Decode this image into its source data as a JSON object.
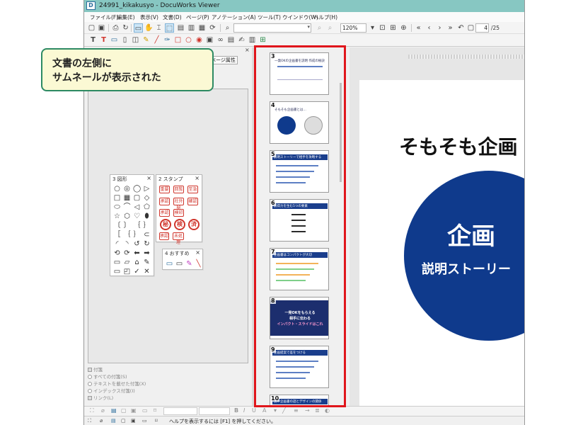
{
  "window": {
    "title": "24991_kikakusyo - DocuWorks Viewer",
    "app_icon": "docuworks-app-icon"
  },
  "menu": [
    "ファイル(F)",
    "編集(E)",
    "表示(V)",
    "文書(D)",
    "ページ(P)",
    "アノテーション(A)",
    "ツール(T)",
    "ウインドウ(W)",
    "ヘルプ(H)"
  ],
  "toolbar": {
    "zoom": "120%",
    "page_current": "4",
    "page_total": "/25"
  },
  "annotation_tabs": [
    "集",
    "ページ属性"
  ],
  "palettes": {
    "shapes": {
      "title": "3 図形"
    },
    "stamps": {
      "title": "2 スタンプ",
      "labels": [
        "重要",
        "回覧",
        "至急",
        "承認",
        "社外秘",
        "確認",
        "承認",
        "検印"
      ],
      "round": [
        "秘",
        "検",
        "済"
      ],
      "extra": [
        "承認",
        "未処理"
      ]
    },
    "recommended": {
      "title": "4 おすすめ"
    }
  },
  "fuseni": {
    "title": "付箋",
    "options": [
      "すべての付箋(S)",
      "テキストを載せた付箋(X)",
      "インデックス付箋(I)"
    ],
    "link": "リンク(L)"
  },
  "thumbnails": [
    {
      "num": "3",
      "kind": "title",
      "title": "一発OKの企画書を説明 作成の秘訣"
    },
    {
      "num": "4",
      "kind": "circles",
      "title": "そもそも企画書とは…"
    },
    {
      "num": "5",
      "kind": "list",
      "title": "説明ストーリーで相手を攻略する"
    },
    {
      "num": "6",
      "kind": "photo",
      "title": "説得力を生む5つの要素"
    },
    {
      "num": "7",
      "kind": "chart",
      "title": "企画書はコンパクトが大切"
    },
    {
      "num": "8",
      "kind": "dark",
      "title": "一発OKをもらえる\n相手に伝わる\nインパクト・スライドはこれ"
    },
    {
      "num": "9",
      "kind": "table",
      "title": "企画提案で差をつける"
    },
    {
      "num": "10",
      "kind": "bar",
      "title": "良い企画書の話とデザインの関係"
    }
  ],
  "slide": {
    "heading": "そもそも企画",
    "circle_title": "企画",
    "circle_sub": "説明ストーリー"
  },
  "status": "ヘルプを表示するには [F1] を押してください。",
  "callout": "文書の左側に\nサムネールが表示された",
  "colors": {
    "title_bar": "#87c7c2",
    "highlight": "#e0161c",
    "slide_circle": "#0f3a8c",
    "callout_border": "#2d8a63",
    "callout_bg": "#fbf9d4"
  }
}
